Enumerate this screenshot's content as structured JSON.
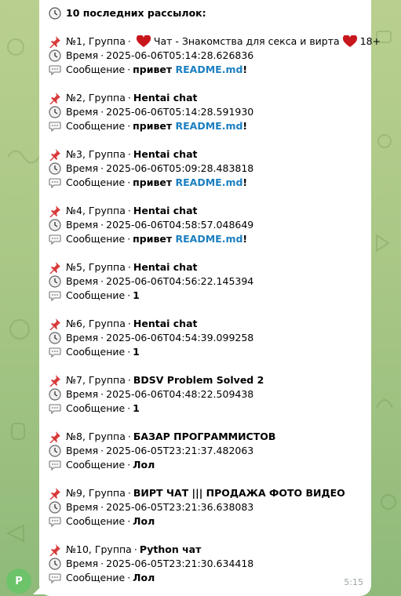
{
  "header": {
    "title": "10 последних рассылок:"
  },
  "labels": {
    "group": "Группа",
    "time": "Время",
    "message": "Сообщение"
  },
  "entries": [
    {
      "num": "№1",
      "group_name": "Чат - Знакомства для секса и вирта",
      "group_suffix": "18+",
      "hearts": true,
      "time": "2025-06-06T05:14:28.626836",
      "msg_text": "привет ",
      "msg_link": "README.md",
      "msg_end": "!"
    },
    {
      "num": "№2",
      "group_name": "Hentai chat",
      "time": "2025-06-06T05:14:28.591930",
      "msg_text": "привет ",
      "msg_link": "README.md",
      "msg_end": "!"
    },
    {
      "num": "№3",
      "group_name": "Hentai chat",
      "time": "2025-06-06T05:09:28.483818",
      "msg_text": "привет ",
      "msg_link": "README.md",
      "msg_end": "!"
    },
    {
      "num": "№4",
      "group_name": "Hentai chat",
      "time": "2025-06-06T04:58:57.048649",
      "msg_text": "привет ",
      "msg_link": "README.md",
      "msg_end": "!"
    },
    {
      "num": "№5",
      "group_name": "Hentai chat",
      "time": "2025-06-06T04:56:22.145394",
      "msg_text": "1"
    },
    {
      "num": "№6",
      "group_name": "Hentai chat",
      "time": "2025-06-06T04:54:39.099258",
      "msg_text": "1"
    },
    {
      "num": "№7",
      "group_name": "BDSV Problem Solved 2",
      "time": "2025-06-06T04:48:22.509438",
      "msg_text": "1"
    },
    {
      "num": "№8",
      "group_name": "БАЗАР ПРОГРАММИСТОВ",
      "time": "2025-06-05T23:21:37.482063",
      "msg_text": "Лол"
    },
    {
      "num": "№9",
      "group_name": "ВИРТ ЧАТ ||| ПРОДАЖА ФОТО ВИДЕО",
      "time": "2025-06-05T23:21:36.638083",
      "msg_text": "Лол"
    },
    {
      "num": "№10",
      "group_name": "Python чат",
      "time": "2025-06-05T23:21:30.634418",
      "msg_text": "Лол"
    }
  ],
  "message_time": "5:15",
  "avatar_letter": "P",
  "colors": {
    "link": "#1b7fc1",
    "avatar": "#6cc36a",
    "background": "#a9c786"
  }
}
